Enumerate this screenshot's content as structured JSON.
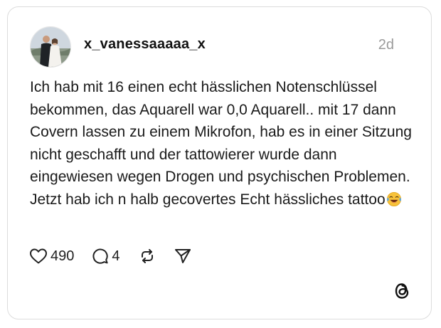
{
  "post": {
    "username": "x_vanessaaaaa_x",
    "time": "2d",
    "text": "Ich hab mit 16 einen echt hässlichen Notenschlüssel bekommen, das Aquarell war 0,0 Aquarell.. mit 17 dann Covern lassen zu einem Mikrofon, hab es in einer Sitzung nicht geschafft und der tattowierer wurde dann eingewiesen wegen Drogen und psychischen Problemen. Jetzt hab ich n halb gecovertes Echt hässliches tattoo",
    "emoji": "face-with-tears-of-joy"
  },
  "actions": {
    "likes": "490",
    "replies": "4"
  },
  "icons": {
    "like": "heart-icon",
    "reply": "comment-bubble-icon",
    "repost": "repost-icon",
    "share": "send-icon",
    "brand": "threads-logo"
  },
  "colors": {
    "text": "#1a1a1a",
    "muted": "#9a9a9a",
    "border": "#dcdcdc",
    "emoji": "#f7c23a"
  }
}
